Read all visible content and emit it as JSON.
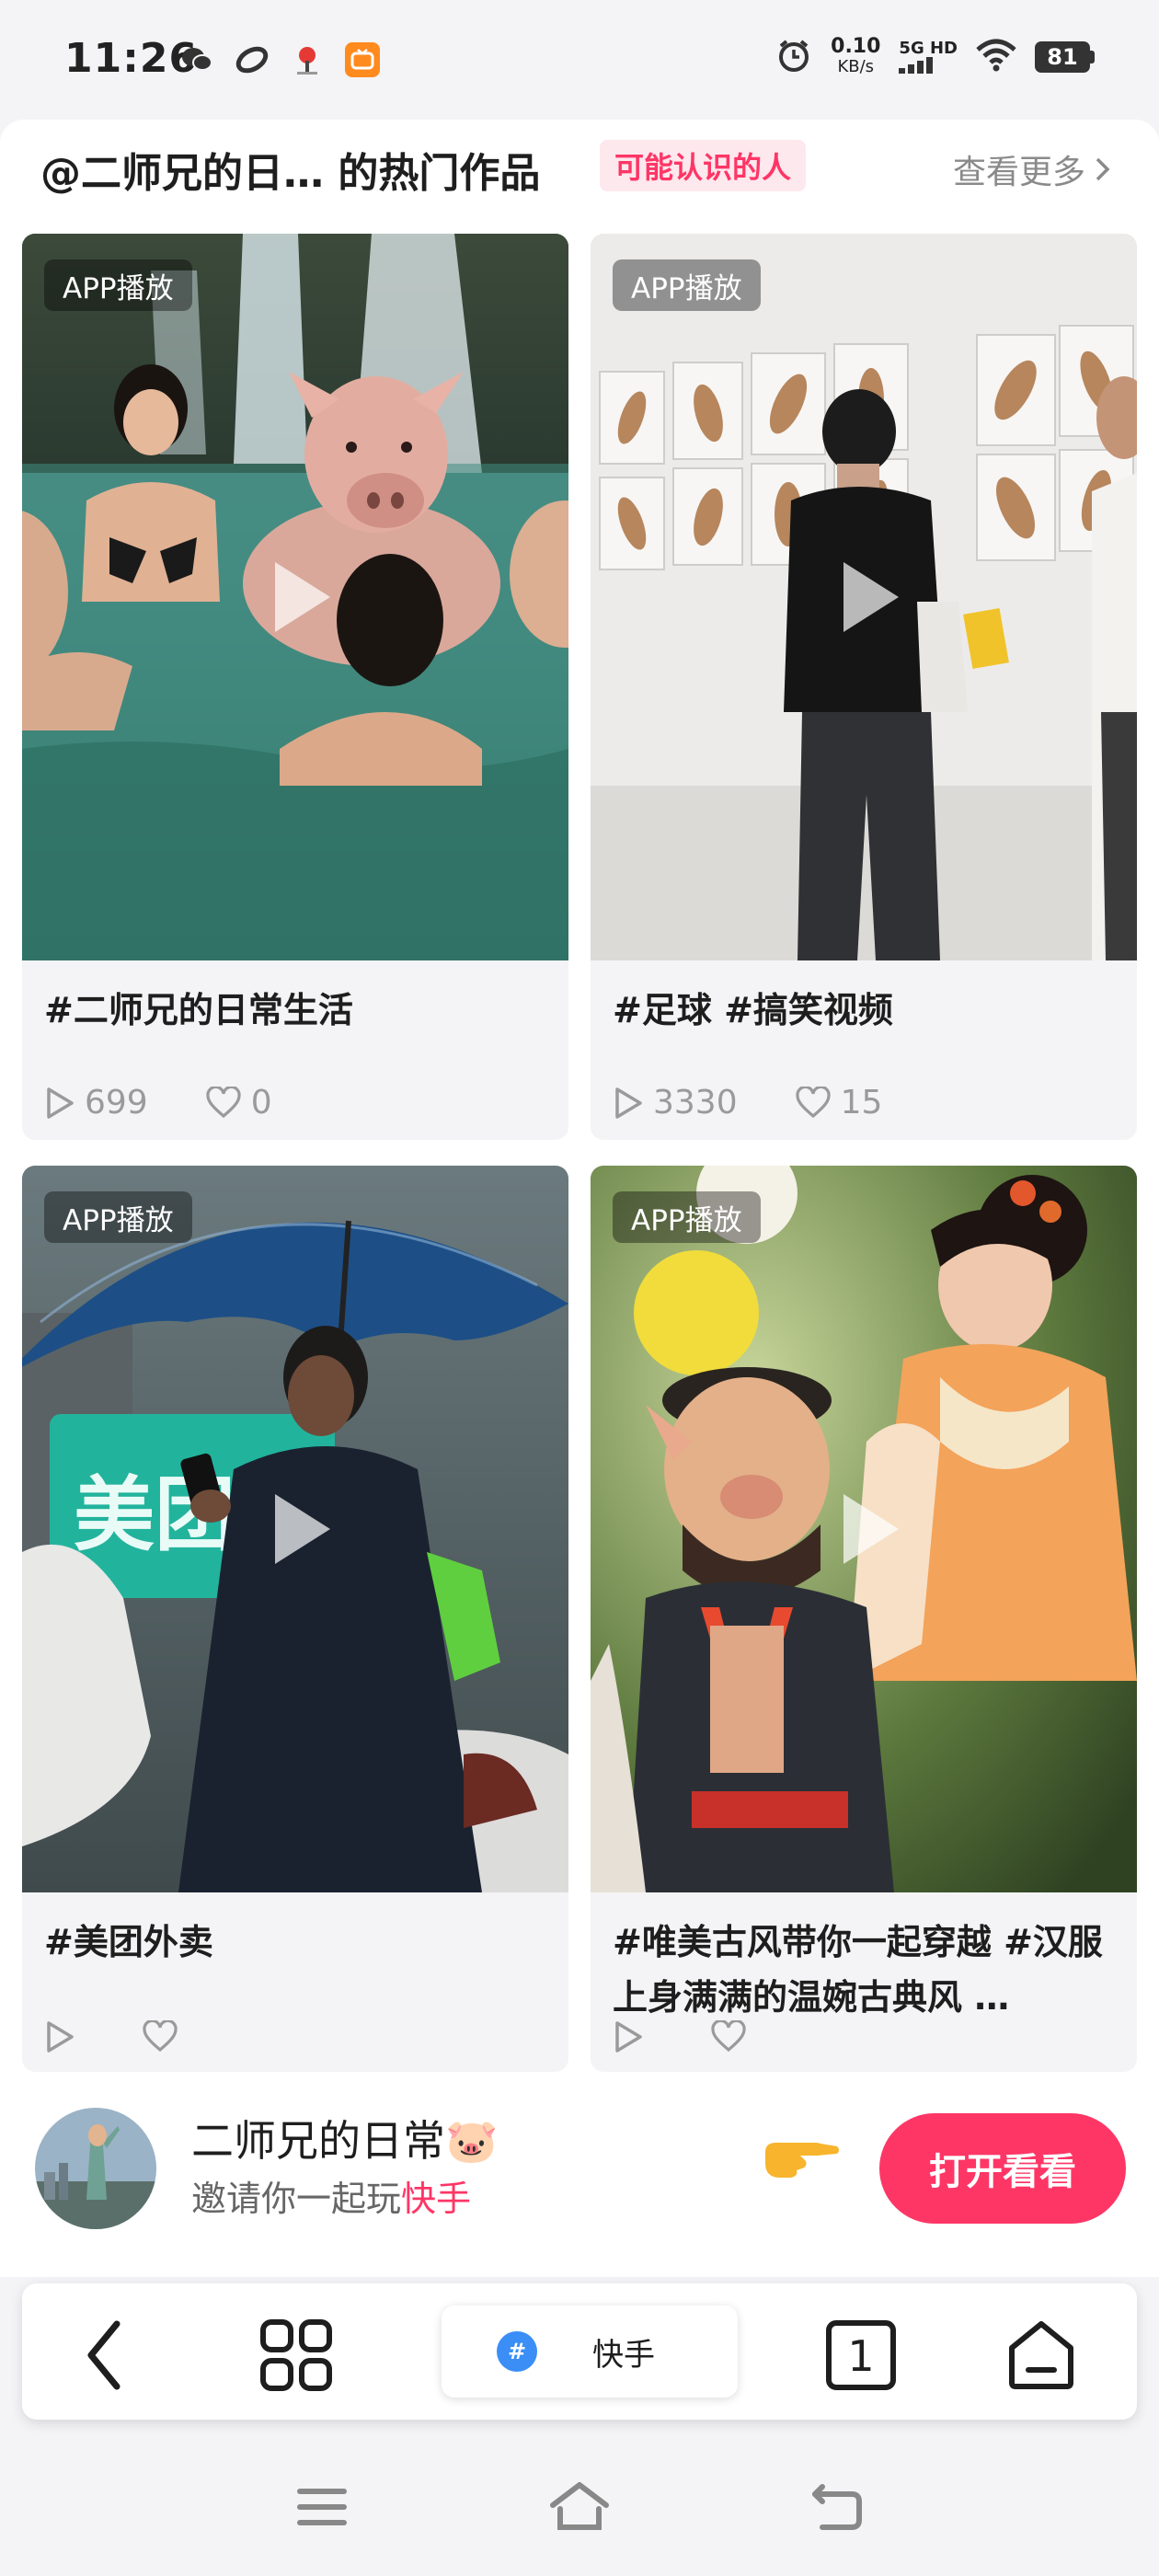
{
  "status_bar": {
    "time": "11:26",
    "net_speed_value": "0.10",
    "net_speed_unit": "KB/s",
    "signal_label": "5G HD",
    "battery": "81"
  },
  "section": {
    "title": "@二师兄的日… 的热门作品",
    "relation_badge": "可能认识的人",
    "see_more": "查看更多"
  },
  "cards": [
    {
      "badge": "APP播放",
      "title": "#二师兄的日常生活",
      "plays": "699",
      "likes": "0"
    },
    {
      "badge": "APP播放",
      "title": "#足球 #搞笑视频",
      "plays": "3330",
      "likes": "15"
    },
    {
      "badge": "APP播放",
      "title": "#美团外卖",
      "plays": "",
      "likes": ""
    },
    {
      "badge": "APP播放",
      "title": "#唯美古风带你一起穿越 #汉服上身满满的温婉古典风 …",
      "plays": "",
      "likes": ""
    }
  ],
  "card3_sign": "美团",
  "invite": {
    "name": "二师兄的日常🐷",
    "text_prefix": "邀请你一起玩",
    "app_name": "快手",
    "open_button": "打开看看"
  },
  "browser": {
    "url_label": "快手",
    "site_icon": "#",
    "tab_count": "1"
  },
  "colors": {
    "accent": "#fe3666",
    "badge_bg": "#fde8ee",
    "text_muted": "#9a9a9a"
  }
}
